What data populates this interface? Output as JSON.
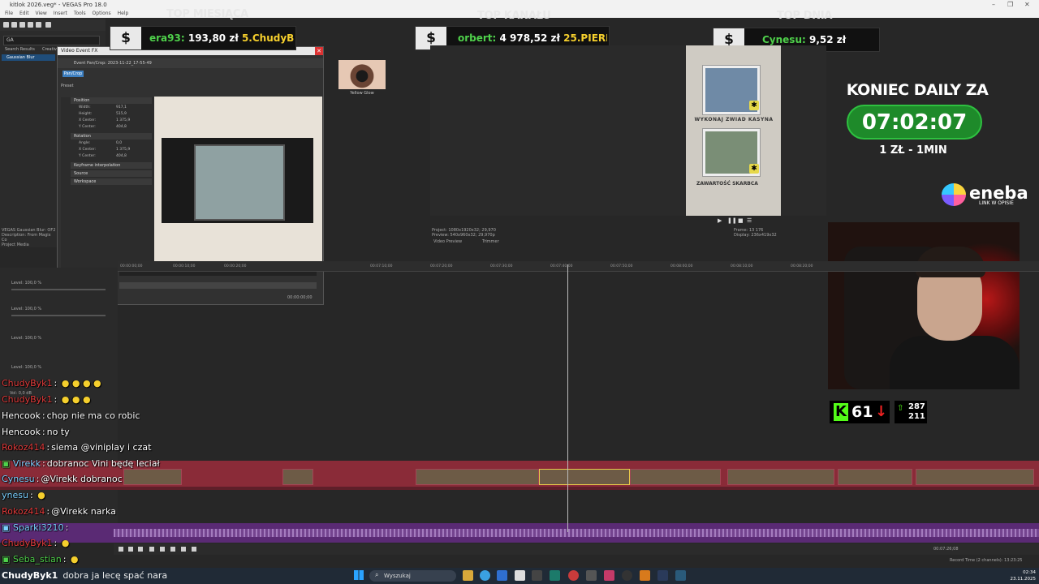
{
  "window": {
    "title": "kitlok 2026.veg* - VEGAS Pro 18.0"
  },
  "menu": [
    "File",
    "Edit",
    "View",
    "Insert",
    "Tools",
    "Options",
    "Help"
  ],
  "left_panel": {
    "search_value": "GA",
    "tabs": [
      "Search Results",
      "Creative"
    ],
    "selected_fx": "Gaussian Blur",
    "description_lines": [
      "VEGAS Gaussian Blur: OF2",
      "Description: From Magix Co",
      "Project Media"
    ]
  },
  "fx_dialog": {
    "title": "Video Event FX",
    "chain": "Event Pan/Crop: 2023-11-22_17-55-49",
    "pan_crop_button": "Pan/Crop",
    "preset_label": "Preset",
    "sections": {
      "position": "Position",
      "rotation": "Rotation",
      "keyframe": "Keyframe interpolation",
      "source": "Source",
      "workspace": "Workspace"
    },
    "position_rows": [
      {
        "label": "Width:",
        "value": "917,1"
      },
      {
        "label": "Height:",
        "value": "515,9"
      },
      {
        "label": "X Center:",
        "value": "1 375,9"
      },
      {
        "label": "Y Center:",
        "value": "404,8"
      }
    ],
    "rotation_rows": [
      {
        "label": "Angle:",
        "value": "0,0"
      },
      {
        "label": "X Center:",
        "value": "1 375,9"
      },
      {
        "label": "Y Center:",
        "value": "404,8"
      }
    ],
    "kf_labels": [
      "Position",
      "Mask"
    ],
    "time": "00:00:00;00"
  },
  "yellow_glow_label": "Yellow Glow",
  "overlays": {
    "top_month": {
      "title": "TOP MIESIĄCA",
      "user": "era93:",
      "amount": "193,80 zł",
      "next": "5.ChudyB"
    },
    "top_channel": {
      "title": "TOP KANAŁU",
      "user": "orbert:",
      "amount": "4 978,52 zł",
      "next": "25.PIERD"
    },
    "top_day": {
      "title": "TOP DNIA",
      "user": "Cynesu:",
      "amount": "9,52 zł"
    },
    "dollar": "$",
    "koniec": "KONIEC DAILY ZA",
    "timer": "07:02:07",
    "rate": "1 ZŁ - 1MIN",
    "sponsor": {
      "name": "eneba",
      "sub": "LINK W OPISIE"
    },
    "kick": {
      "letter": "K",
      "viewers": "61",
      "followers_up": "287",
      "followers_total": "211"
    }
  },
  "preview": {
    "frame_caption_1": "WYKONAJ ZWIAD KASYNA",
    "frame_caption_2": "ZAWARTOŚĆ SKARBCA",
    "info_left": [
      "Project:  1080x1920x32; 29,970",
      "Preview: 540x960x32; 29,970p",
      "Video Preview",
      "Trimmer"
    ],
    "info_right": [
      "Frame:   13 176",
      "Display:  236x419x32"
    ]
  },
  "timeline": {
    "ticks": [
      "00:00:00;00",
      "00:00:10;00",
      "00:00:20;00",
      "00:07:10;00",
      "00:07:20;00",
      "00:07:30;00",
      "00:07:40;00",
      "00:07:50;00",
      "00:08:00;00",
      "00:08:10;00",
      "00:08:20;00",
      "00:08:30;00",
      "00:08:40;00"
    ],
    "level_label": "Level: 100,0 %",
    "vol_label": "Vol:",
    "vol_value": "0,0 dB",
    "record_time": "Record Time (2 channels): 13:23:25",
    "cursor_time": "00:07:26;08"
  },
  "chat": [
    {
      "user": "ChudyByk1",
      "color": "#e23a3a",
      "text": "",
      "emotes": true
    },
    {
      "user": "ChudyByk1",
      "color": "#e23a3a",
      "text": "",
      "emotes": true
    },
    {
      "user": "Hencook",
      "color": "#ffffff",
      "text": "chop nie ma co robic"
    },
    {
      "user": "Hencook",
      "color": "#ffffff",
      "text": "no ty"
    },
    {
      "user": "Rokoz414",
      "color": "#e23a3a",
      "text": "siema @viniplay i czat"
    },
    {
      "user": "Virekk",
      "color": "#7ad0ff",
      "text": "dobranoc Vini będę leciał"
    },
    {
      "user": "Cynesu",
      "color": "#7ad0ff",
      "text": "@Virekk dobranoc"
    },
    {
      "user": "ynesu",
      "color": "#7ad0ff",
      "text": ""
    },
    {
      "user": "Rokoz414",
      "color": "#e23a3a",
      "text": "@Virekk narka"
    },
    {
      "user": "Sparki3210",
      "color": "#7ad0ff",
      "text": ""
    },
    {
      "user": "ChudyByk1",
      "color": "#e23a3a",
      "text": ""
    },
    {
      "user": "Seba_stian",
      "color": "#4fd14b",
      "text": ""
    }
  ],
  "taskbar": {
    "search": "Wyszukaj",
    "time": "02:34",
    "date": "23.11.2025",
    "last_chat_user": "ChudyByk1",
    "last_chat_text": "dobra ja lecę spać nara"
  },
  "colors": {
    "kick_green": "#53fc18",
    "timer_green": "#1e8a2a",
    "video_track": "#8a2b38",
    "audio_track": "#5a2a74"
  }
}
